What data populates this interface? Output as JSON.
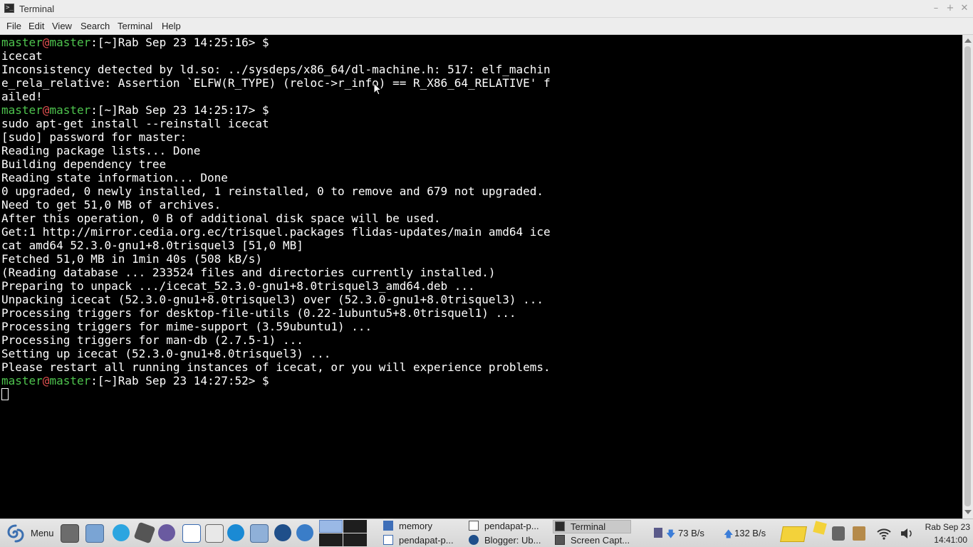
{
  "window": {
    "title": "Terminal",
    "controls": [
      "minimize-icon",
      "maximize-icon",
      "close-icon"
    ]
  },
  "menubar": [
    "File",
    "Edit",
    "View",
    "Search",
    "Terminal",
    "Help"
  ],
  "terminal": {
    "prompt": {
      "user": "master",
      "at": "@",
      "host": "master",
      "rest": ":[~]Rab Sep 23 14:25:16> $",
      "rest2": ":[~]Rab Sep 23 14:25:17> $",
      "rest3": ":[~]Rab Sep 23 14:27:52> $"
    },
    "lines": [
      "icecat",
      "Inconsistency detected by ld.so: ../sysdeps/x86_64/dl-machine.h: 517: elf_machin",
      "e_rela_relative: Assertion `ELFW(R_TYPE) (reloc->r_info) == R_X86_64_RELATIVE' f",
      "ailed!",
      "sudo apt-get install --reinstall icecat",
      "[sudo] password for master:",
      "Reading package lists... Done",
      "Building dependency tree",
      "Reading state information... Done",
      "0 upgraded, 0 newly installed, 1 reinstalled, 0 to remove and 679 not upgraded.",
      "Need to get 51,0 MB of archives.",
      "After this operation, 0 B of additional disk space will be used.",
      "Get:1 http://mirror.cedia.org.ec/trisquel.packages flidas-updates/main amd64 ice",
      "cat amd64 52.3.0-gnu1+8.0trisquel3 [51,0 MB]",
      "Fetched 51,0 MB in 1min 40s (508 kB/s)",
      "(Reading database ... 233524 files and directories currently installed.)",
      "Preparing to unpack .../icecat_52.3.0-gnu1+8.0trisquel3_amd64.deb ...",
      "Unpacking icecat (52.3.0-gnu1+8.0trisquel3) over (52.3.0-gnu1+8.0trisquel3) ...",
      "Processing triggers for desktop-file-utils (0.22-1ubuntu5+8.0trisquel1) ...",
      "Processing triggers for mime-support (3.59ubuntu1) ...",
      "Processing triggers for man-db (2.7.5-1) ...",
      "Setting up icecat (52.3.0-gnu1+8.0trisquel3) ...",
      "Please restart all running instances of icecat, or you will experience problems."
    ]
  },
  "taskbar": {
    "menu_label": "Menu",
    "tasks": {
      "memory": "memory",
      "pendapat1": "pendapat-p...",
      "pendapat2": "pendapat-p...",
      "blogger": "Blogger: Ub...",
      "terminal": "Terminal",
      "screencap": "Screen Capt..."
    },
    "net_down": "73 B/s",
    "net_up": "132 B/s",
    "clock_date": "Rab Sep 23",
    "clock_time": "14:41:00"
  },
  "colors": {
    "prompt_user": "#4ec44e",
    "prompt_at": "#e05050",
    "terminal_bg": "#000000",
    "terminal_fg": "#ffffff"
  }
}
